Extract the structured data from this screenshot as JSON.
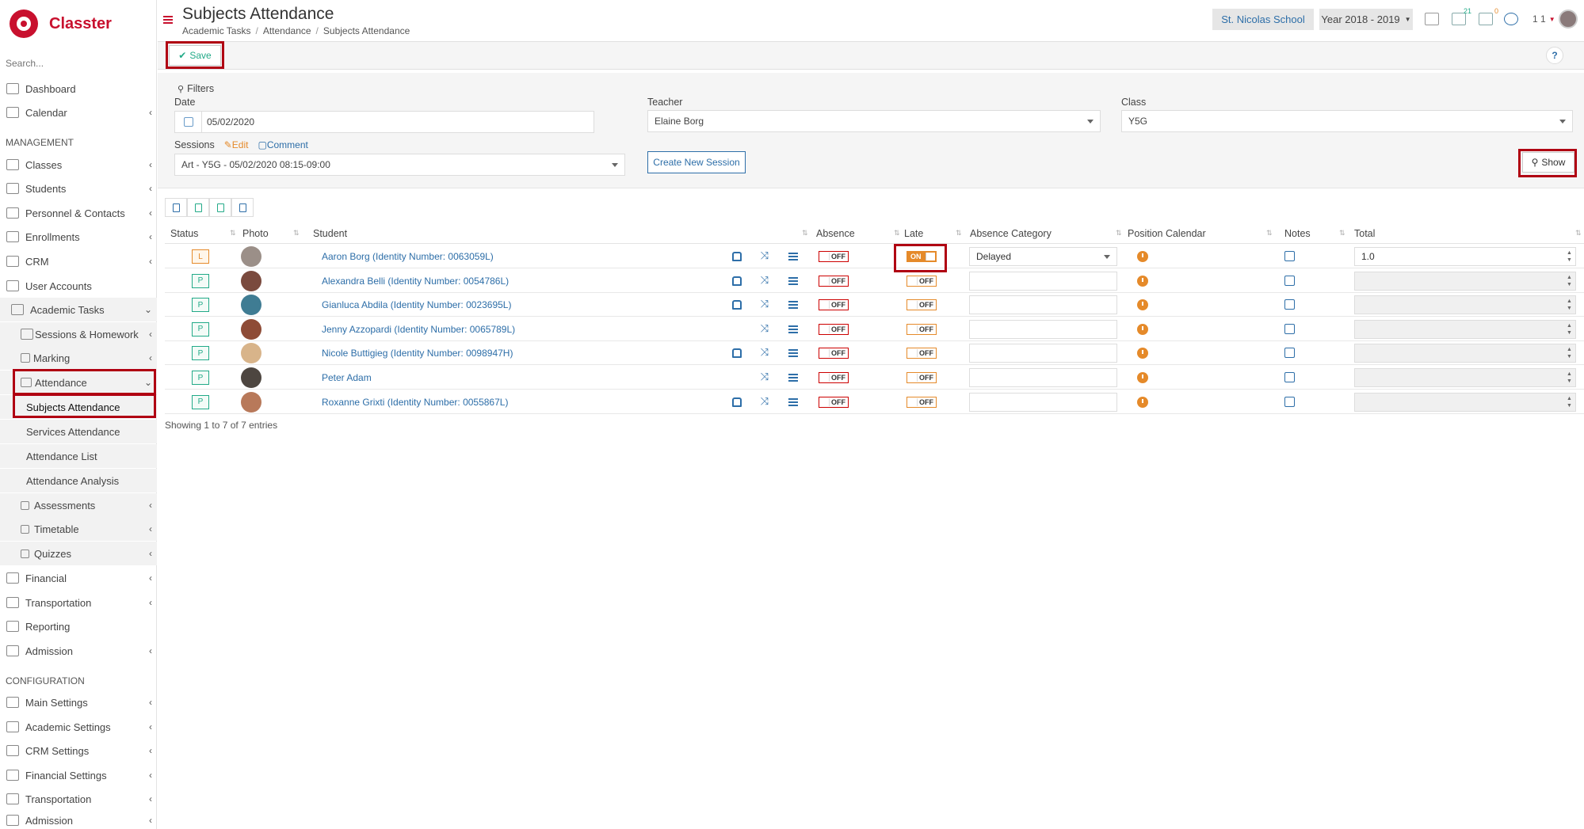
{
  "app": {
    "name": "Classter"
  },
  "sidebar": {
    "search_placeholder": "Search...",
    "items": [
      {
        "label": "Dashboard",
        "icon": "dashboard-icon"
      },
      {
        "label": "Calendar",
        "icon": "calendar-icon"
      },
      {
        "heading": "MANAGEMENT"
      },
      {
        "label": "Classes",
        "icon": "classes-icon"
      },
      {
        "label": "Students",
        "icon": "students-icon"
      },
      {
        "label": "Personnel & Contacts",
        "icon": "personnel-icon"
      },
      {
        "label": "Enrollments",
        "icon": "enrollments-icon"
      },
      {
        "label": "CRM",
        "icon": "crm-icon"
      },
      {
        "label": "User Accounts",
        "icon": "key-icon"
      },
      {
        "label": "Academic Tasks",
        "icon": "grid-icon"
      },
      {
        "label": "Sessions & Homework",
        "icon": "book-icon"
      },
      {
        "label": "Marking",
        "icon": "pencil-icon"
      },
      {
        "label": "Attendance",
        "icon": "user-check-icon"
      },
      {
        "label": "Subjects Attendance"
      },
      {
        "label": "Services Attendance"
      },
      {
        "label": "Attendance List"
      },
      {
        "label": "Attendance Analysis"
      },
      {
        "label": "Assessments",
        "icon": "pencil-square-icon"
      },
      {
        "label": "Timetable",
        "icon": "timetable-icon"
      },
      {
        "label": "Quizzes",
        "icon": "quiz-icon"
      },
      {
        "label": "Financial",
        "icon": "money-icon"
      },
      {
        "label": "Transportation",
        "icon": "bus-icon"
      },
      {
        "label": "Reporting",
        "icon": "print-icon"
      },
      {
        "label": "Admission",
        "icon": "bank-icon"
      },
      {
        "heading": "CONFIGURATION"
      },
      {
        "label": "Main Settings",
        "icon": "sliders-icon"
      },
      {
        "label": "Academic Settings",
        "icon": "users-icon"
      },
      {
        "label": "CRM Settings",
        "icon": "crm-icon"
      },
      {
        "label": "Financial Settings",
        "icon": "money-icon"
      },
      {
        "label": "Transportation",
        "icon": "bus-icon"
      },
      {
        "label": "Admission",
        "icon": "bank-icon"
      }
    ]
  },
  "header": {
    "title": "Subjects Attendance",
    "breadcrumb": [
      "Academic Tasks",
      "Attendance",
      "Subjects Attendance"
    ],
    "school": "St. Nicolas School",
    "year": "Year 2018 - 2019",
    "badge_messages": "21",
    "badge_mail": "0",
    "user_short": "1 1"
  },
  "toolbar": {
    "save_label": "Save",
    "help_label": "?"
  },
  "filters": {
    "title": "Filters",
    "date_label": "Date",
    "date_value": "05/02/2020",
    "teacher_label": "Teacher",
    "teacher_value": "Elaine Borg",
    "class_label": "Class",
    "class_value": "Y5G",
    "sessions_label": "Sessions",
    "edit_label": "Edit",
    "comment_label": "Comment",
    "session_value": "Art - Y5G - 05/02/2020 08:15-09:00",
    "create_session_label": "Create New Session",
    "show_label": "Show"
  },
  "table": {
    "columns": [
      "Status",
      "Photo",
      "Student",
      "Absence",
      "Late",
      "Absence Category",
      "Position Calendar",
      "Notes",
      "Total"
    ],
    "rows": [
      {
        "status": "L",
        "student": "Aaron Borg (Identity Number: 0063059L)",
        "absence": "OFF",
        "late": "ON",
        "category": "Delayed",
        "total": "1.0",
        "bus": true,
        "photo_color": "#9b8f88"
      },
      {
        "status": "P",
        "student": "Alexandra Belli (Identity Number: 0054786L)",
        "absence": "OFF",
        "late": "OFF",
        "category": "",
        "total": "",
        "bus": true,
        "photo_color": "#7a4a3e"
      },
      {
        "status": "P",
        "student": "Gianluca Abdila (Identity Number: 0023695L)",
        "absence": "OFF",
        "late": "OFF",
        "category": "",
        "total": "",
        "bus": true,
        "photo_color": "#3f7c93"
      },
      {
        "status": "P",
        "student": "Jenny Azzopardi (Identity Number: 0065789L)",
        "absence": "OFF",
        "late": "OFF",
        "category": "",
        "total": "",
        "bus": false,
        "photo_color": "#8e4b36"
      },
      {
        "status": "P",
        "student": "Nicole Buttigieg (Identity Number: 0098947H)",
        "absence": "OFF",
        "late": "OFF",
        "category": "",
        "total": "",
        "bus": true,
        "photo_color": "#d8b48a"
      },
      {
        "status": "P",
        "student": "Peter Adam",
        "absence": "OFF",
        "late": "OFF",
        "category": "",
        "total": "",
        "bus": false,
        "photo_color": "#4d4640"
      },
      {
        "status": "P",
        "student": "Roxanne Grixti (Identity Number: 0055867L)",
        "absence": "OFF",
        "late": "OFF",
        "category": "",
        "total": "",
        "bus": true,
        "photo_color": "#b8795a"
      }
    ],
    "footer": "Showing 1 to 7 of 7 entries"
  },
  "colors": {
    "brand": "#c8102e",
    "link": "#2d6ea8",
    "present": "#22aa88",
    "late": "#e58a2a",
    "highlight": "#b00012"
  }
}
